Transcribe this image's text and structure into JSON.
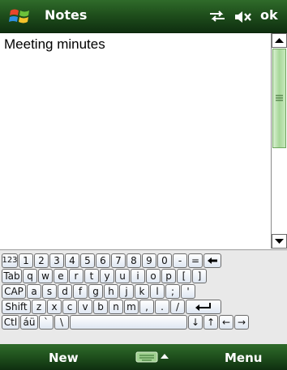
{
  "titlebar": {
    "app_title": "Notes",
    "ok_label": "ok"
  },
  "note": {
    "text": "Meeting minutes"
  },
  "keyboard": {
    "rows": [
      [
        "123",
        "1",
        "2",
        "3",
        "4",
        "5",
        "6",
        "7",
        "8",
        "9",
        "0",
        "-",
        "=",
        "←"
      ],
      [
        "Tab",
        "q",
        "w",
        "e",
        "r",
        "t",
        "y",
        "u",
        "i",
        "o",
        "p",
        "[",
        "]"
      ],
      [
        "CAP",
        "a",
        "s",
        "d",
        "f",
        "g",
        "h",
        "j",
        "k",
        "l",
        ";",
        "'"
      ],
      [
        "Shift",
        "z",
        "x",
        "c",
        "v",
        "b",
        "n",
        "m",
        ",",
        ".",
        "/",
        "↵"
      ],
      [
        "Ctl",
        "áü",
        "`",
        "\\",
        "",
        "↓",
        "↑",
        "←",
        "→"
      ]
    ]
  },
  "softbar": {
    "left_label": "New",
    "right_label": "Menu"
  },
  "colors": {
    "bar_green": "#1f4f1c",
    "scroll_thumb": "#a8d89a"
  }
}
